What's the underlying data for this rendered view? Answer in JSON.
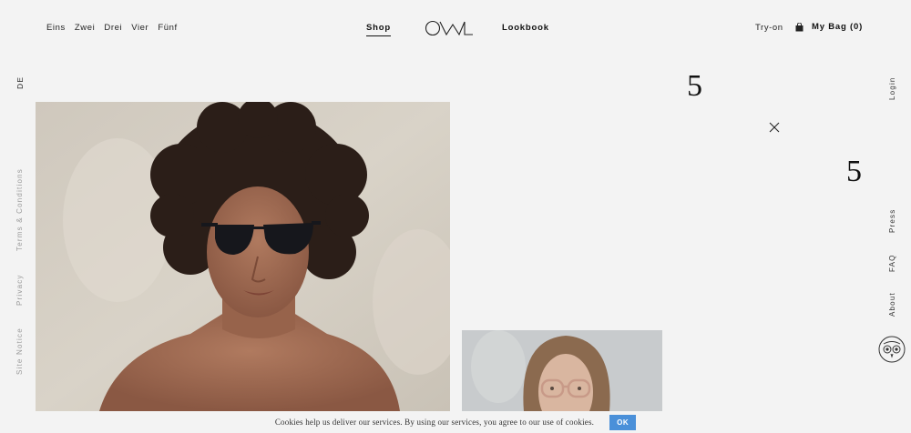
{
  "header": {
    "nav_left": [
      "Eins",
      "Zwei",
      "Drei",
      "Vier",
      "Fünf"
    ],
    "shop": "Shop",
    "logo_alt": "OWL",
    "lookbook": "Lookbook",
    "try_on": "Try-on",
    "bag": "My Bag (0)"
  },
  "left_rail": {
    "language": "DE",
    "terms": "Terms & Conditions",
    "privacy": "Privacy",
    "site_notice": "Site Notice"
  },
  "right_rail": {
    "login": "Login",
    "press": "Press",
    "faq": "FAQ",
    "about": "About"
  },
  "content": {
    "number_top": "5",
    "number_right": "5"
  },
  "cookie": {
    "text": "Cookies help us deliver our services. By using our services, you agree to our use of cookies.",
    "ok": "OK",
    "accent": "#4a90d9"
  },
  "icons": [
    "bag-icon",
    "close-icon",
    "owl-face-icon"
  ]
}
